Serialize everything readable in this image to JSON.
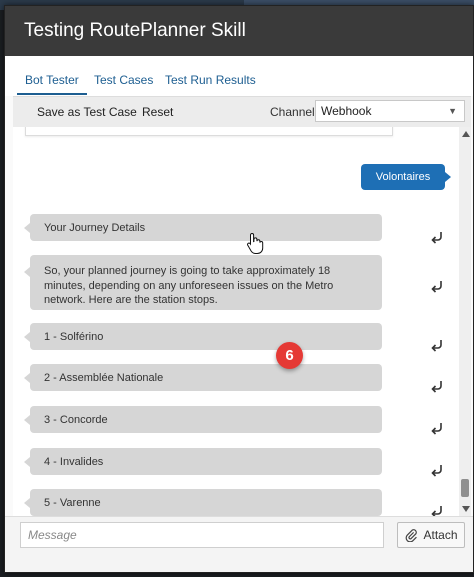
{
  "dialog": {
    "title": "Testing RoutePlanner Skill"
  },
  "tabs": [
    {
      "label": "Bot Tester",
      "active": true
    },
    {
      "label": "Test Cases",
      "active": false
    },
    {
      "label": "Test Run Results",
      "active": false
    }
  ],
  "toolbar": {
    "save_label": "Save as Test Case",
    "reset_label": "Reset",
    "channel_label": "Channel",
    "channel_value": "Webhook"
  },
  "conversation": {
    "user_message": "Volontaires",
    "bot_messages": [
      "Your Journey Details",
      "So, your planned journey is going to take approximately 18 minutes, depending on any unforeseen issues on the Metro network. Here are the station stops.",
      "1 - Solférino",
      "2 - Assemblée Nationale",
      "3 - Concorde",
      "4 - Invalides",
      "5 - Varenne"
    ]
  },
  "composer": {
    "placeholder": "Message",
    "attach_label": "Attach"
  },
  "annotation": {
    "step_number": "6"
  },
  "icons": {
    "reply": "reply-arrow-icon",
    "attach": "paperclip-icon",
    "dropdown": "chevron-down-icon",
    "cursor": "hand-pointer-icon"
  },
  "colors": {
    "titlebar": "#3a3a3a",
    "accent": "#1e6fb5",
    "bot_bubble": "#d6d6d6",
    "badge": "#e53935"
  }
}
